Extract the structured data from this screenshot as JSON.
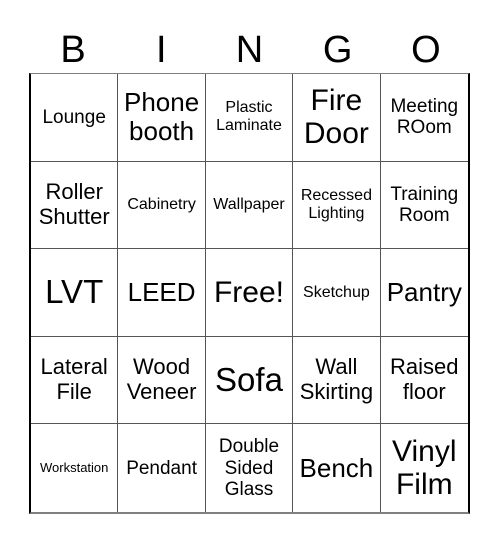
{
  "header": {
    "letters": [
      "B",
      "I",
      "N",
      "G",
      "O"
    ]
  },
  "cells": [
    "Lounge",
    "Phone\nbooth",
    "Plastic\nLaminate",
    "Fire\nDoor",
    "Meeting\nROom",
    "Roller\nShutter",
    "Cabinetry",
    "Wallpaper",
    "Recessed\nLighting",
    "Training\nRoom",
    "LVT",
    "LEED",
    "Free!",
    "Sketchup",
    "Pantry",
    "Lateral\nFile",
    "Wood\nVeneer",
    "Sofa",
    "Wall\nSkirting",
    "Raised\nfloor",
    "Workstation",
    "Pendant",
    "Double\nSided\nGlass",
    "Bench",
    "Vinyl\nFilm"
  ],
  "free_space": "Free!"
}
